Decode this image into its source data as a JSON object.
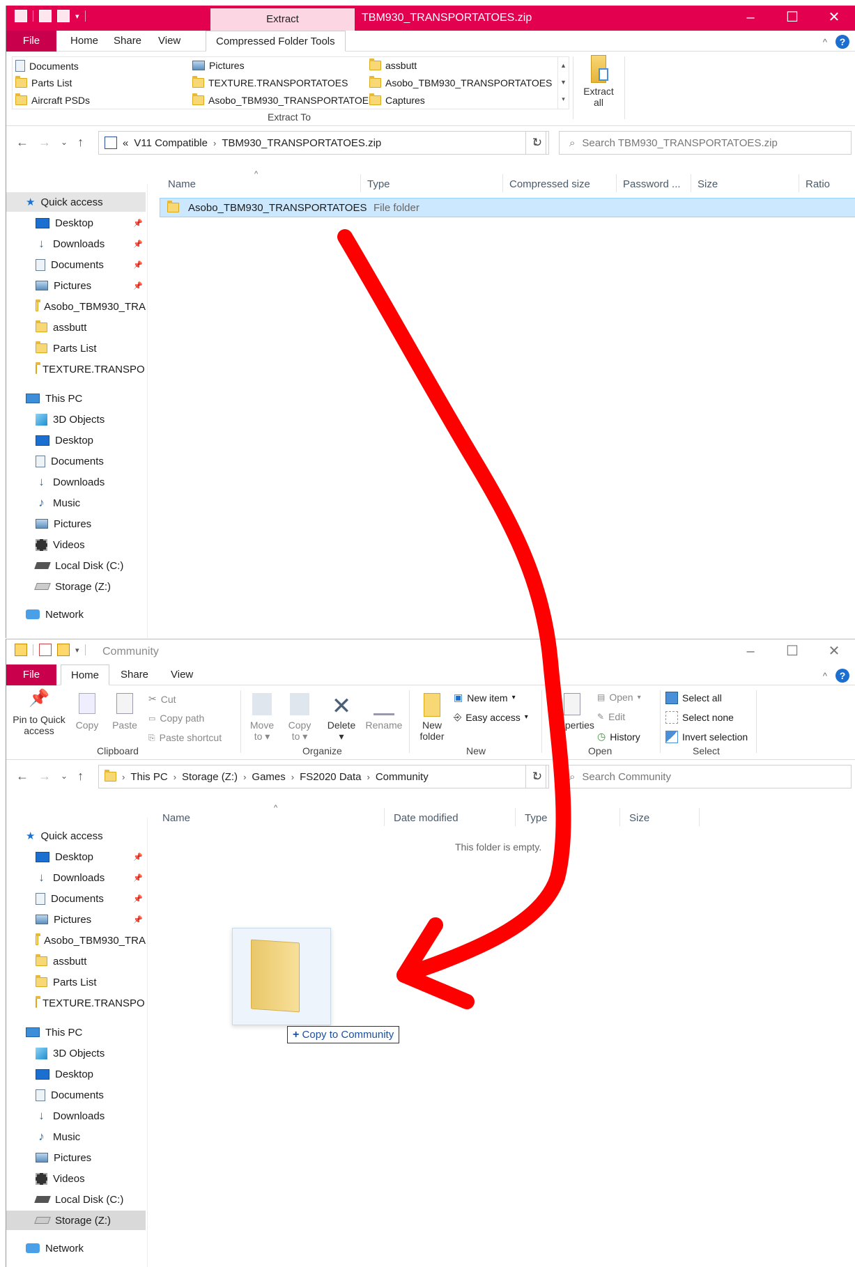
{
  "accent": "#e3004f",
  "win1": {
    "context_tab": "Extract",
    "title": "TBM930_TRANSPORTATOES.zip",
    "tabs": {
      "file": "File",
      "home": "Home",
      "share": "Share",
      "view": "View",
      "tools": "Compressed Folder Tools"
    },
    "gallery": [
      [
        "Documents",
        "Pictures",
        "assbutt"
      ],
      [
        "Parts List",
        "TEXTURE.TRANSPORTATOES",
        "Asobo_TBM930_TRANSPORTATOES"
      ],
      [
        "Aircraft PSDs",
        "Asobo_TBM930_TRANSPORTATOES",
        "Captures"
      ]
    ],
    "extract_to_label": "Extract To",
    "extract_all_line1": "Extract",
    "extract_all_line2": "all",
    "address": {
      "prefix": "«",
      "crumb1": "V11 Compatible",
      "crumb2": "TBM930_TRANSPORTATOES.zip"
    },
    "search_placeholder": "Search TBM930_TRANSPORTATOES.zip",
    "columns": [
      "Name",
      "Type",
      "Compressed size",
      "Password ...",
      "Size",
      "Ratio"
    ],
    "row": {
      "name": "Asobo_TBM930_TRANSPORTATOES",
      "type": "File folder"
    }
  },
  "nav": {
    "quick_access": "Quick access",
    "quick_items": [
      "Desktop",
      "Downloads",
      "Documents",
      "Pictures",
      "Asobo_TBM930_TRA",
      "assbutt",
      "Parts List",
      "TEXTURE.TRANSPOI"
    ],
    "this_pc": "This PC",
    "pc_items": [
      "3D Objects",
      "Desktop",
      "Documents",
      "Downloads",
      "Music",
      "Pictures",
      "Videos",
      "Local Disk (C:)",
      "Storage (Z:)"
    ],
    "network": "Network"
  },
  "win2": {
    "title": "Community",
    "tabs": {
      "file": "File",
      "home": "Home",
      "share": "Share",
      "view": "View"
    },
    "ribbon": {
      "pin_line1": "Pin to Quick",
      "pin_line2": "access",
      "copy": "Copy",
      "paste": "Paste",
      "cut": "Cut",
      "copy_path": "Copy path",
      "paste_shortcut": "Paste shortcut",
      "clipboard": "Clipboard",
      "move_to_line1": "Move",
      "move_to_line2": "to",
      "copy_to_line1": "Copy",
      "copy_to_line2": "to",
      "delete": "Delete",
      "rename": "Rename",
      "organize": "Organize",
      "new_folder_line1": "New",
      "new_folder_line2": "folder",
      "new_item": "New item",
      "easy_access": "Easy access",
      "new": "New",
      "properties": "Properties",
      "open_btn": "Open",
      "edit": "Edit",
      "history": "History",
      "open": "Open",
      "select_all": "Select all",
      "select_none": "Select none",
      "invert_selection": "Invert selection",
      "select": "Select"
    },
    "address": {
      "crumbs": [
        "This PC",
        "Storage (Z:)",
        "Games",
        "FS2020 Data",
        "Community"
      ]
    },
    "search_placeholder": "Search Community",
    "columns": [
      "Name",
      "Date modified",
      "Type",
      "Size"
    ],
    "empty_text": "This folder is empty.",
    "drag_tip_plus": "+",
    "drag_tip": "Copy to Community"
  }
}
